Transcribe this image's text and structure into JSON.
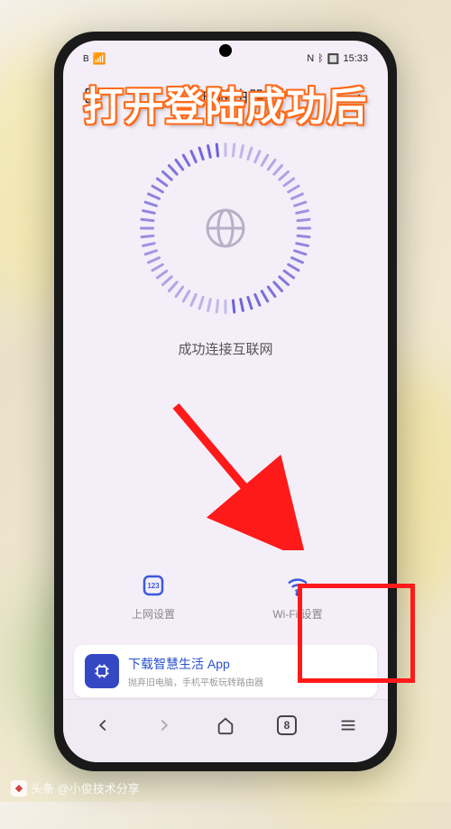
{
  "status_bar": {
    "signal_label": "B",
    "wifi_indicator": "⚡",
    "nfc": "N",
    "bt": "⚲",
    "battery": "▢",
    "time": "15:33"
  },
  "overlay": {
    "caption": "打开登陆成功后"
  },
  "header": {
    "title": "我的路由器"
  },
  "main": {
    "status_text": "成功连接互联网"
  },
  "bottom_buttons": {
    "net": {
      "label": "上网设置",
      "icon_badge": "123"
    },
    "wifi": {
      "label": "Wi-Fi 设置"
    }
  },
  "promo": {
    "title": "下载智慧生活 App",
    "subtitle": "抛弃旧电脑，手机平板玩转路由器"
  },
  "browser_nav": {
    "tab_count": "8"
  },
  "watermark": {
    "text": "头条 @小俊技术分享"
  }
}
